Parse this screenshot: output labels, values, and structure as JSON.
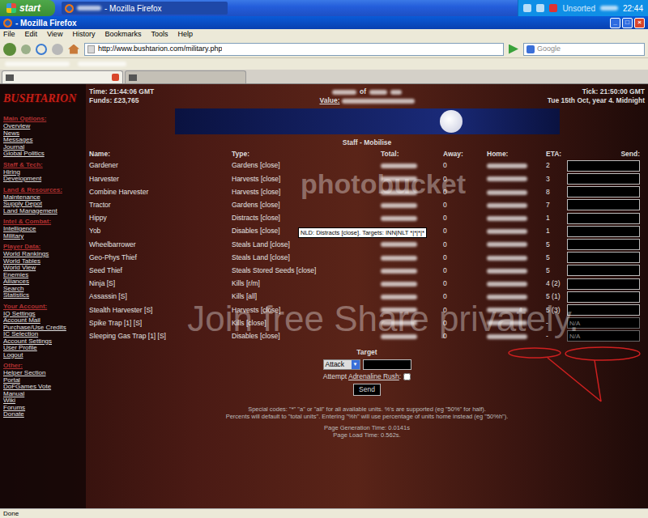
{
  "taskbar": {
    "start": "start",
    "tasks": [
      {
        "label": "- Mozilla Firefox",
        "selected": true
      }
    ],
    "tray_label": "Unsorted",
    "clock": "22:44"
  },
  "window": {
    "title": "- Mozilla Firefox",
    "controls": [
      "_",
      "□",
      "×"
    ]
  },
  "menu": [
    "File",
    "Edit",
    "View",
    "History",
    "Bookmarks",
    "Tools",
    "Help"
  ],
  "navbar": {
    "url": "http://www.bushtarion.com/military.php",
    "search_placeholder": "Google"
  },
  "tabs": [
    {
      "selected": true
    },
    {
      "selected": false
    }
  ],
  "page": {
    "logo": "BUSHTARION",
    "header": {
      "time": "Time: 21:44:06 GMT",
      "funds": "Funds: £23,765",
      "center_of": "of",
      "value_label": "Value:",
      "tick": "Tick: 21:50:00 GMT",
      "date": "Tue 15th Oct, year 4. Midnight"
    },
    "sidebar": [
      {
        "title": "Main Options:",
        "items": [
          "Overview",
          "News",
          "Messages",
          "Journal",
          "Global Politics"
        ]
      },
      {
        "title": "Staff & Tech:",
        "items": [
          "Hiring",
          "Development"
        ]
      },
      {
        "title": "Land & Resources:",
        "items": [
          "Maintenance",
          "Supply Depot",
          "Land Management"
        ]
      },
      {
        "title": "Intel & Combat:",
        "items": [
          "Intelligence",
          "Military"
        ]
      },
      {
        "title": "Player Data:",
        "items": [
          "World Rankings",
          "World Tables",
          "World View",
          "Enemies",
          "Alliances",
          "Search",
          "Statistics"
        ]
      },
      {
        "title": "Your Account:",
        "items": [
          "IQ Settings",
          "Account Mail",
          "Purchase/Use Credits",
          "IC Selection",
          "Account Settings",
          "User Profile",
          "Logout"
        ]
      },
      {
        "title": "Other:",
        "items": [
          "Helper Section",
          "Portal",
          "DoFGames Vote",
          "Manual",
          "Wiki",
          "Forums",
          "Donate"
        ]
      }
    ],
    "table": {
      "title": "Staff - Mobilise",
      "columns": [
        "Name:",
        "Type:",
        "Total:",
        "Away:",
        "Home:",
        "ETA:",
        "Send:"
      ],
      "rows": [
        {
          "name": "Gardener",
          "type": "Gardens [close]",
          "total_redacted": true,
          "away": "0",
          "home_redacted": true,
          "eta": "2",
          "send": {
            "placeholder": "",
            "disabled": false
          }
        },
        {
          "name": "Harvester",
          "type": "Harvests [close]",
          "total_redacted": true,
          "away": "0",
          "home_redacted": true,
          "eta": "3",
          "send": {
            "placeholder": "",
            "disabled": false
          }
        },
        {
          "name": "Combine Harvester",
          "type": "Harvests [close]",
          "total_redacted": true,
          "away": "0",
          "home_redacted": true,
          "eta": "8",
          "send": {
            "placeholder": "",
            "disabled": false
          }
        },
        {
          "name": "Tractor",
          "type": "Gardens [close]",
          "total_redacted": true,
          "away": "0",
          "home_redacted": true,
          "eta": "7",
          "send": {
            "placeholder": "",
            "disabled": false
          }
        },
        {
          "name": "Hippy",
          "type": "Distracts [close]",
          "total_redacted": true,
          "away": "0",
          "home_redacted": true,
          "eta": "1",
          "send": {
            "placeholder": "",
            "disabled": false
          }
        },
        {
          "name": "Yob",
          "type": "Disables [close]",
          "total_redacted": true,
          "away": "0",
          "home_redacted": true,
          "eta": "1",
          "send": {
            "placeholder": "",
            "disabled": false
          }
        },
        {
          "name": "Wheelbarrower",
          "type": "Steals Land [close]",
          "total_redacted": true,
          "away": "0",
          "home_redacted": true,
          "eta": "5",
          "send": {
            "placeholder": "",
            "disabled": false
          }
        },
        {
          "name": "Geo-Phys Thief",
          "type": "Steals Land [close]",
          "total_redacted": true,
          "away": "0",
          "home_redacted": true,
          "eta": "5",
          "send": {
            "placeholder": "",
            "disabled": false
          }
        },
        {
          "name": "Seed Thief",
          "type": "Steals Stored Seeds [close]",
          "total_redacted": true,
          "away": "0",
          "home_redacted": true,
          "eta": "5",
          "send": {
            "placeholder": "",
            "disabled": false
          }
        },
        {
          "name": "Ninja [S]",
          "type": "Kills [r/m]",
          "total_redacted": true,
          "away": "0",
          "home_redacted": true,
          "eta": "4 (2)",
          "send": {
            "placeholder": "",
            "disabled": false
          }
        },
        {
          "name": "Assassin [S]",
          "type": "Kills [all]",
          "total_redacted": true,
          "away": "0",
          "home_redacted": true,
          "eta": "5 (1)",
          "send": {
            "placeholder": "",
            "disabled": false
          }
        },
        {
          "name": "Stealth Harvester [S]",
          "type": "Harvests [close]",
          "total_redacted": true,
          "away": "0",
          "home_redacted": true,
          "eta": "5 (3)",
          "send": {
            "placeholder": "",
            "disabled": false
          }
        },
        {
          "name": "Spike Trap [1] [S]",
          "type": "Kills [close]",
          "total_redacted": true,
          "away": "0",
          "home_redacted": true,
          "eta": "-",
          "send": {
            "placeholder": "N/A",
            "disabled": true
          }
        },
        {
          "name": "Sleeping Gas Trap [1] [S]",
          "type": "Disables [close]",
          "total_redacted": true,
          "away": "0",
          "home_redacted": true,
          "eta": "-",
          "send": {
            "placeholder": "N/A",
            "disabled": true
          }
        }
      ]
    },
    "tooltip": "NLD: Distracts [close]. Targets: INN|NLT *|*|*|*",
    "target": {
      "label": "Target",
      "action": "Attack",
      "arrow": "▼",
      "value": "",
      "adrenaline": {
        "prefix": "Attempt ",
        "link": "Adrenaline Rush",
        "suffix": ":",
        "checked": false
      },
      "button": "Send"
    },
    "footer": [
      "Special codes: \"*\" \"a\" or \"all\" for all available units. %'s are supported (eg \"50%\" for half).",
      "Percents will default to \"total units\". Entering \"%h\" will use percentage of units home instead (eg \"50%h\").",
      "Page Generation Time: 0.0141s",
      "Page Load Time: 0.562s."
    ],
    "watermark": {
      "brand": "photobucket",
      "slogan": "Join free Share privately."
    }
  },
  "status_bar": "Done"
}
